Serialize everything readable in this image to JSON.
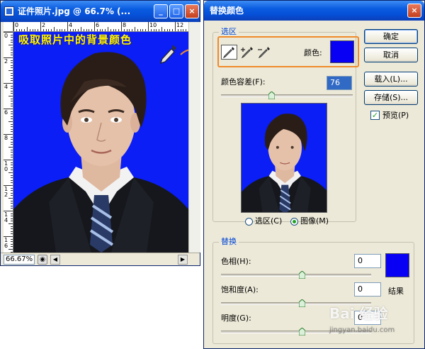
{
  "image_window": {
    "title": "证件照片.jpg @ 66.7% (...",
    "minimize_glyph": "_",
    "maximize_glyph": "□",
    "close_glyph": "×",
    "ruler_h_labels": [
      "0",
      "2",
      "4",
      "6",
      "8",
      "10",
      "12"
    ],
    "ruler_v_labels": [
      "0",
      "2",
      "4",
      "6",
      "8",
      "1 0",
      "1 2",
      "1 4",
      "1 6"
    ],
    "annotation": "吸取照片中的背景颜色",
    "background_color": "#0a1ef5",
    "zoom": "66.67%",
    "nav_glyph": "◉",
    "scroll_left_glyph": "◀",
    "scroll_right_glyph": "▶"
  },
  "dialog": {
    "title": "替换颜色",
    "close_glyph": "×",
    "selection_group_label": "选区",
    "color_label": "颜色:",
    "selected_color": "#0800f5",
    "fuzziness_label": "颜色容差(F):",
    "fuzziness_value": "76",
    "fuzziness_fraction": 0.38,
    "radio_selection_label": "选区(C)",
    "radio_image_label": "图像(M)",
    "buttons": {
      "ok": "确定",
      "cancel": "取消",
      "load": "载入(L)...",
      "save": "存储(S)..."
    },
    "preview_label": "预览(P)",
    "preview_checked": true,
    "check_glyph": "✓",
    "replace_group_label": "替换",
    "hue_label": "色相(H):",
    "hue_value": "0",
    "saturation_label": "饱和度(A):",
    "saturation_value": "0",
    "lightness_label": "明度(G):",
    "lightness_value": "0",
    "result_label": "结果",
    "result_color": "#0800f5"
  },
  "watermark": {
    "text": "Bai 经验",
    "sub": "jingyan.baidu.com"
  }
}
